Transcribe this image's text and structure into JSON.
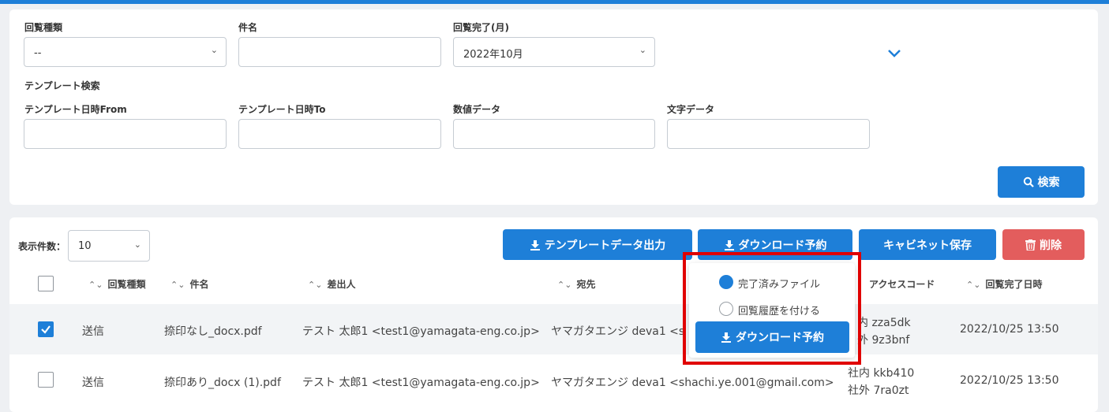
{
  "search": {
    "kind_label": "回覧種類",
    "kind_value": "--",
    "subject_label": "件名",
    "subject_value": "",
    "month_label": "回覧完了(月)",
    "month_value": "2022年10月",
    "template_section_label": "テンプレート検索",
    "template_from_label": "テンプレート日時From",
    "template_to_label": "テンプレート日時To",
    "numeric_label": "数値データ",
    "text_label": "文字データ",
    "search_button": "検索"
  },
  "toolbar": {
    "page_size_label": "表示件数：",
    "page_size_value": "10",
    "template_export_button": "テンプレートデータ出力",
    "download_reserve_button": "ダウンロード予約",
    "cabinet_save_button": "キャビネット保存",
    "delete_button": "削除"
  },
  "popover": {
    "option_completed": "完了済みファイル",
    "option_history": "回覧履歴を付ける",
    "selected_option": "完了済みファイル",
    "confirm_button": "ダウンロード予約"
  },
  "table": {
    "headers": [
      "回覧種類",
      "件名",
      "差出人",
      "宛先",
      "アクセスコード",
      "回覧完了日時"
    ],
    "rows": [
      {
        "checked": true,
        "kind": "送信",
        "subject": "捺印なし_docx.pdf",
        "sender": "テスト 太郎1 <test1@yamagata-eng.co.jp>",
        "recipient": "ヤマガタエンジ deva1 <s",
        "access_in": "内 zza5dk",
        "access_out": "外 9z3bnf",
        "completed": "2022/10/25 13:50"
      },
      {
        "checked": false,
        "kind": "送信",
        "subject": "捺印あり_docx (1).pdf",
        "sender": "テスト 太郎1 <test1@yamagata-eng.co.jp>",
        "recipient": "ヤマガタエンジ deva1 <shachi.ye.001@gmail.com>",
        "access_in": "社内 kkb410",
        "access_out": "社外 7ra0zt",
        "completed": "2022/10/25 13:50"
      }
    ]
  },
  "colors": {
    "accent": "#1e7fd8",
    "danger": "#e35d5d",
    "highlight": "#e00000"
  }
}
